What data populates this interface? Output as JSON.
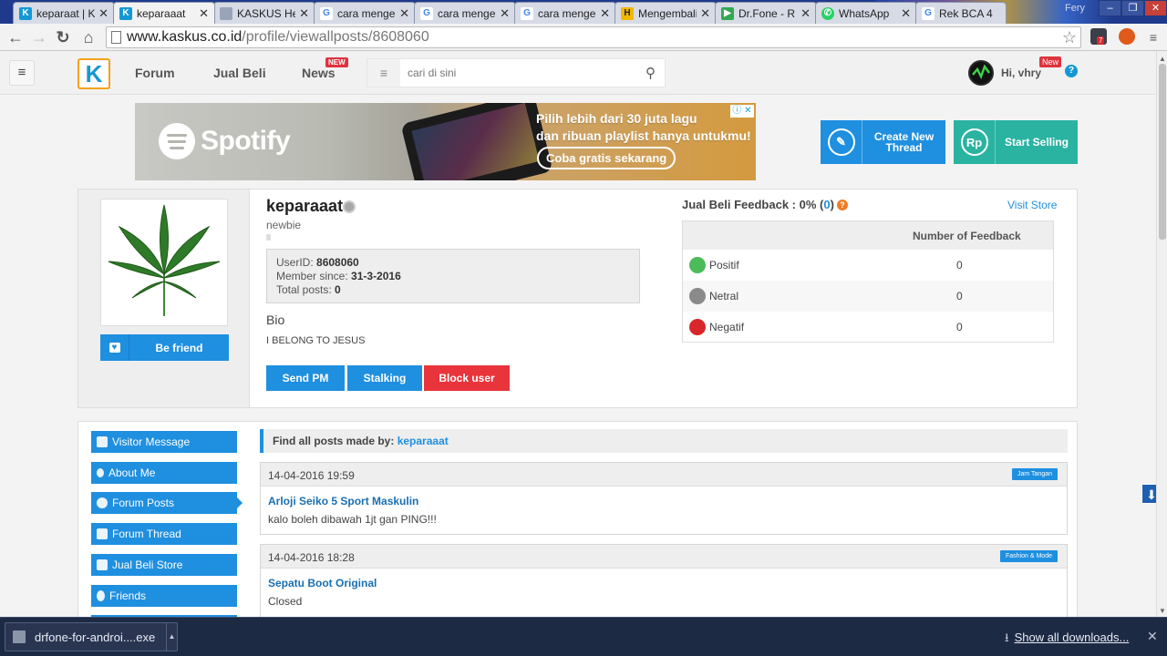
{
  "browser": {
    "tabs": [
      {
        "title": "keparaat | Kaskus",
        "favicon": "kaskus-icon",
        "color": "#1498d5"
      },
      {
        "title": "keparaaat",
        "favicon": "kaskus-icon",
        "color": "#1498d5"
      },
      {
        "title": "KASKUS Help",
        "favicon": "page-icon",
        "color": "#9aa4b8"
      },
      {
        "title": "cara mengembalikan",
        "favicon": "google-icon",
        "color": "#4285f4"
      },
      {
        "title": "cara mengembalikan",
        "favicon": "google-icon",
        "color": "#4285f4"
      },
      {
        "title": "cara mengembalikan",
        "favicon": "google-icon",
        "color": "#4285f4"
      },
      {
        "title": "Mengembalikan",
        "favicon": "h-icon",
        "color": "#f2b705"
      },
      {
        "title": "Dr.Fone - R",
        "favicon": "play-icon",
        "color": "#34a853"
      },
      {
        "title": "WhatsApp",
        "favicon": "whatsapp-icon",
        "color": "#25d366"
      },
      {
        "title": "Rek BCA 4",
        "favicon": "google-icon",
        "color": "#4285f4"
      }
    ],
    "profile_user": "Fery",
    "url_host": "www.kaskus.co.id",
    "url_path": "/profile/viewallposts/8608060",
    "extension_badge": "7"
  },
  "header": {
    "nav": {
      "forum": "Forum",
      "jual_beli": "Jual Beli",
      "news": "News",
      "news_badge": "NEW"
    },
    "search_placeholder": "cari di sini",
    "greeting": "Hi, vhry",
    "user_badge": "New",
    "help": "?"
  },
  "banner": {
    "brand": "Spotify",
    "line1": "Pilih lebih dari 30 juta lagu",
    "line2": "dan ribuan playlist hanya untukmu!",
    "cta": "Coba gratis sekarang",
    "close": "ⓘ ✕"
  },
  "actions": {
    "create_thread": "Create New Thread",
    "start_selling": "Start Selling",
    "create_color": "#1f8fe0",
    "selling_color": "#2ab3a1"
  },
  "profile": {
    "username": "keparaaat",
    "rank": "newbie",
    "user_id_label": "UserID:",
    "user_id": "8608060",
    "member_since_label": "Member since:",
    "member_since": "31-3-2016",
    "total_posts_label": "Total posts:",
    "total_posts": "0",
    "bio_label": "Bio",
    "bio_text": "I BELONG TO JESUS",
    "be_friend": "Be friend",
    "send_pm": "Send PM",
    "stalking": "Stalking",
    "block_user": "Block user",
    "block_color": "#e8343a"
  },
  "feedback": {
    "title_prefix": "Jual Beli Feedback : 0% (",
    "title_count": "0",
    "title_suffix": ")",
    "visit_store": "Visit Store",
    "column_header": "Number of Feedback",
    "rows": [
      {
        "label": "Positif",
        "count": "0",
        "color": "#4cbb5a"
      },
      {
        "label": "Netral",
        "count": "0",
        "color": "#8a8a8a"
      },
      {
        "label": "Negatif",
        "count": "0",
        "color": "#d9262b"
      }
    ]
  },
  "sidebar": {
    "items": [
      {
        "label": "Visitor Message"
      },
      {
        "label": "About Me"
      },
      {
        "label": "Forum Posts"
      },
      {
        "label": "Forum Thread"
      },
      {
        "label": "Jual Beli Store"
      },
      {
        "label": "Friends"
      }
    ],
    "active_index": 2
  },
  "posts_section": {
    "find_label": "Find all posts made by:",
    "find_user": "keparaaat",
    "posts": [
      {
        "date": "14-04-2016 19:59",
        "tag": "Jam Tangan",
        "title": "Arloji Seiko 5 Sport Maskulin",
        "body": "kalo boleh dibawah 1jt gan PING!!!"
      },
      {
        "date": "14-04-2016 18:28",
        "tag": "Fashion & Mode",
        "title": "Sepatu Boot Original",
        "body": "Closed"
      }
    ]
  },
  "downloads": {
    "file_name": "drfone-for-androi....exe",
    "show_all": "Show all downloads..."
  }
}
